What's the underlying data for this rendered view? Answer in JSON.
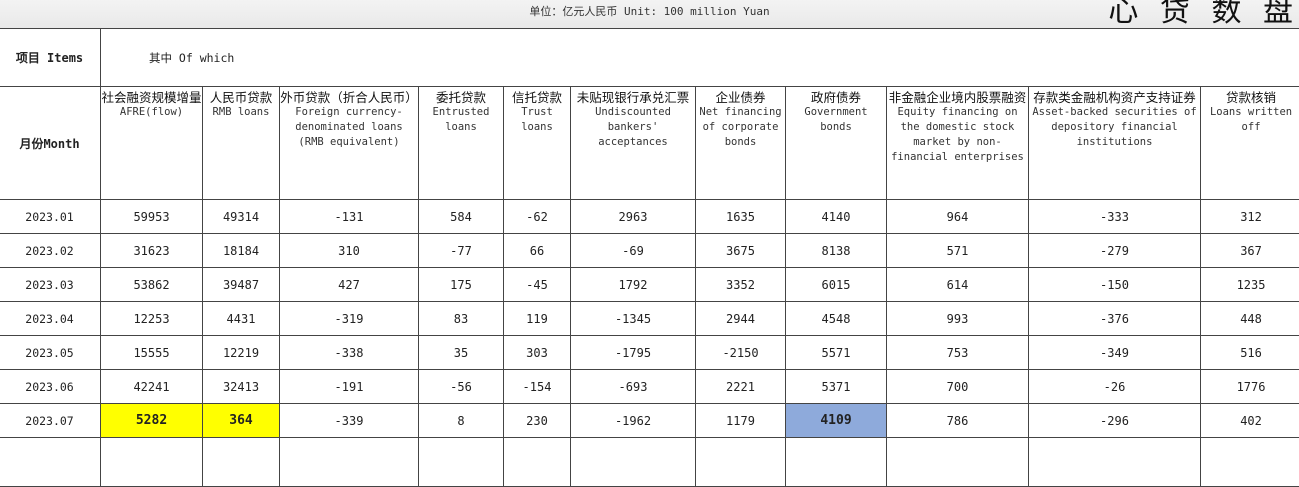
{
  "page": {
    "unit": "单位：亿元人民币  Unit: 100 million Yuan",
    "corner_text": "心 贷 数 盘"
  },
  "table": {
    "stub_items": "项目 Items",
    "stub_month": "月份Month",
    "of_which": "其中 Of which",
    "columns": [
      {
        "zh": "社会融资规模增量",
        "en": "AFRE(flow)"
      },
      {
        "zh": "人民币贷款",
        "en": "RMB loans"
      },
      {
        "zh": "外币贷款（折合人民币）",
        "en": "Foreign currency-\ndenominated loans\n(RMB equivalent)"
      },
      {
        "zh": "委托贷款",
        "en": "Entrusted\nloans"
      },
      {
        "zh": "信托贷款",
        "en": "Trust loans"
      },
      {
        "zh": "未贴现银行承兑汇票",
        "en": "Undiscounted\nbankers' acceptances"
      },
      {
        "zh": "企业债券",
        "en": "Net financing\nof corporate\nbonds"
      },
      {
        "zh": "政府债券",
        "en": "Government\nbonds"
      },
      {
        "zh": "非金融企业境内股票融资",
        "en": "Equity financing on\nthe domestic stock\nmarket by non-\nfinancial enterprises"
      },
      {
        "zh": "存款类金融机构资产支持证券",
        "en": "Asset-backed securities of\ndepository financial\ninstitutions"
      },
      {
        "zh": "贷款核销",
        "en": "Loans written\noff"
      }
    ],
    "rows": [
      {
        "month": "2023.01",
        "values": [
          "59953",
          "49314",
          "-131",
          "584",
          "-62",
          "2963",
          "1635",
          "4140",
          "964",
          "-333",
          "312"
        ]
      },
      {
        "month": "2023.02",
        "values": [
          "31623",
          "18184",
          "310",
          "-77",
          "66",
          "-69",
          "3675",
          "8138",
          "571",
          "-279",
          "367"
        ]
      },
      {
        "month": "2023.03",
        "values": [
          "53862",
          "39487",
          "427",
          "175",
          "-45",
          "1792",
          "3352",
          "6015",
          "614",
          "-150",
          "1235"
        ]
      },
      {
        "month": "2023.04",
        "values": [
          "12253",
          "4431",
          "-319",
          "83",
          "119",
          "-1345",
          "2944",
          "4548",
          "993",
          "-376",
          "448"
        ]
      },
      {
        "month": "2023.05",
        "values": [
          "15555",
          "12219",
          "-338",
          "35",
          "303",
          "-1795",
          "-2150",
          "5571",
          "753",
          "-349",
          "516"
        ]
      },
      {
        "month": "2023.06",
        "values": [
          "42241",
          "32413",
          "-191",
          "-56",
          "-154",
          "-693",
          "2221",
          "5371",
          "700",
          "-26",
          "1776"
        ]
      },
      {
        "month": "2023.07",
        "values": [
          "5282",
          "364",
          "-339",
          "8",
          "230",
          "-1962",
          "1179",
          "4109",
          "786",
          "-296",
          "402"
        ]
      }
    ],
    "highlights": {
      "row": 6,
      "yellow_cols": [
        0,
        1
      ],
      "blue_cols": [
        7
      ],
      "yellow": "#ffff00",
      "blue": "#8eaadb"
    }
  }
}
